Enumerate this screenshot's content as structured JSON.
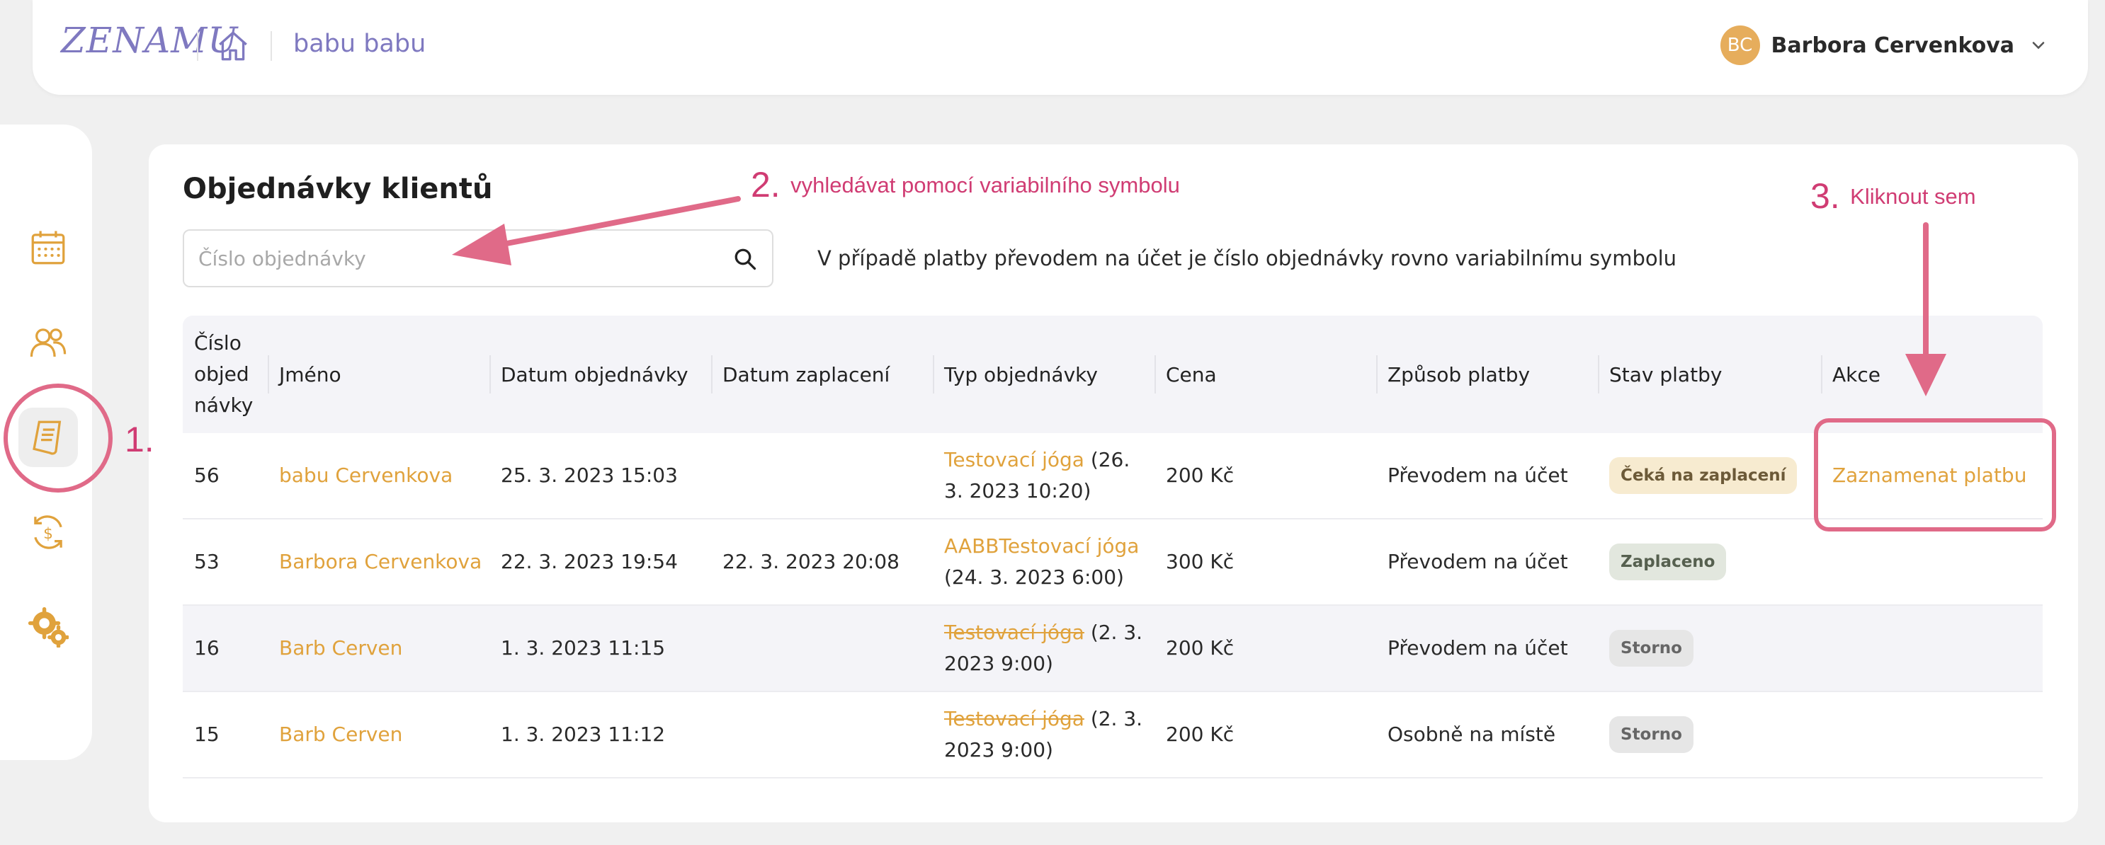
{
  "header": {
    "logo": "ZENAMU",
    "workspace": "babu babu",
    "user": {
      "initials": "BC",
      "name": "Barbora Cervenkova"
    }
  },
  "sidebar": {
    "items": [
      {
        "icon": "calendar-icon"
      },
      {
        "icon": "users-icon"
      },
      {
        "icon": "orders-icon",
        "active": true
      },
      {
        "icon": "payment-icon"
      },
      {
        "icon": "settings-icon"
      }
    ]
  },
  "page": {
    "title": "Objednávky klientů",
    "search_placeholder": "Číslo objednávky",
    "search_hint": "V případě platby převodem na účet je číslo objednávky rovno variabilnímu symbolu"
  },
  "table": {
    "headers": [
      "Číslo objed návky",
      "Jméno",
      "Datum objednávky",
      "Datum zaplacení",
      "Typ objednávky",
      "Cena",
      "Způsob platby",
      "Stav platby",
      "Akce"
    ],
    "rows": [
      {
        "id": "56",
        "name": "babu Cervenkova",
        "ordered": "25. 3. 2023 15:03",
        "paid": "",
        "type_link": "Testovací jóga",
        "type_rest": " (26. 3. 2023 10:20)",
        "price": "200 Kč",
        "method": "Převodem na účet",
        "status": "Čeká na zaplacení",
        "action": "Zaznamenat platbu"
      },
      {
        "id": "53",
        "name": "Barbora Cervenkova",
        "ordered": "22. 3. 2023 19:54",
        "paid": "22. 3. 2023 20:08",
        "type_link": "AABBTestovací jóga",
        "type_rest": " (24. 3. 2023 6:00)",
        "price": "300 Kč",
        "method": "Převodem na účet",
        "status": "Zaplaceno",
        "action": ""
      },
      {
        "id": "16",
        "name": "Barb Cerven",
        "ordered": "1. 3. 2023 11:15",
        "paid": "",
        "type_link": "Testovací jóga",
        "type_rest": " (2. 3. 2023 9:00)",
        "price": "200 Kč",
        "method": "Převodem na účet",
        "status": "Storno",
        "action": ""
      },
      {
        "id": "15",
        "name": "Barb Cerven",
        "ordered": "1. 3. 2023 11:12",
        "paid": "",
        "type_link": "Testovací jóga",
        "type_rest": " (2. 3. 2023 9:00)",
        "price": "200 Kč",
        "method": "Osobně na místě",
        "status": "Storno",
        "action": ""
      }
    ]
  },
  "annotations": {
    "a1": {
      "num": "1."
    },
    "a2": {
      "num": "2.",
      "label": "vyhledávat pomocí variabilního symbolu"
    },
    "a3": {
      "num": "3.",
      "label": "Kliknout sem"
    },
    "color": "#d03c73"
  },
  "colors": {
    "accent": "#e0a23c",
    "brand": "#7f79c0",
    "annotation": "#e06a88"
  }
}
